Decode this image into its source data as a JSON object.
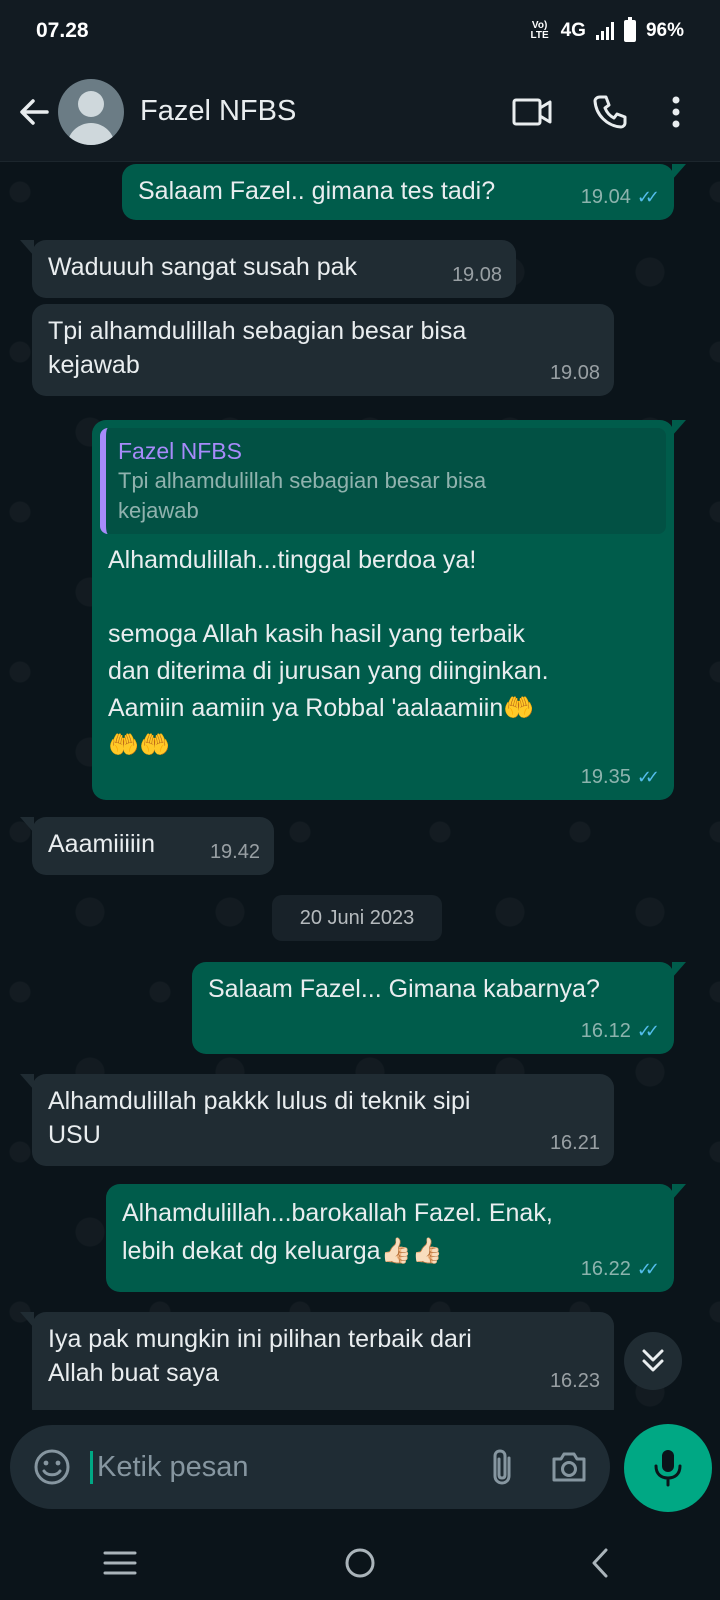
{
  "status_bar": {
    "time": "07.28",
    "volte": "Vo) LTE",
    "network": "4G",
    "battery": "96%"
  },
  "header": {
    "contact_name": "Fazel NFBS",
    "icons": [
      "back-arrow-icon",
      "video-call-icon",
      "voice-call-icon",
      "more-options-icon"
    ]
  },
  "messages": [
    {
      "dir": "out",
      "text": "Salaam Fazel.. gimana tes tadi?",
      "time": "19.04",
      "read": true
    },
    {
      "dir": "in",
      "text": "Waduuuh sangat susah pak",
      "time": "19.08"
    },
    {
      "dir": "in",
      "text": "Tpi alhamdulillah sebagian besar bisa\nkejawab",
      "time": "19.08"
    },
    {
      "dir": "out",
      "reply_to": {
        "name": "Fazel NFBS",
        "text": "Tpi alhamdulillah sebagian besar bisa\nkejawab"
      },
      "text": "Alhamdulillah...tinggal berdoa ya!\n\nsemoga Allah kasih hasil yang terbaik\ndan diterima di jurusan yang diinginkan.\nAamiin aamiin ya Robbal 'aalaamiin🤲\n🤲🤲",
      "time": "19.35",
      "read": true
    },
    {
      "dir": "in",
      "text": "Aaamiiiiin",
      "time": "19.42"
    },
    {
      "dir": "out",
      "text": "Salaam Fazel... Gimana kabarnya?",
      "time": "16.12",
      "read": true
    },
    {
      "dir": "in",
      "text": "Alhamdulillah pakkk lulus di teknik sipi\nUSU",
      "time": "16.21"
    },
    {
      "dir": "out",
      "text": "Alhamdulillah...barokallah Fazel. Enak,\nlebih dekat dg keluarga👍🏻👍🏻",
      "time": "16.22",
      "read": true
    },
    {
      "dir": "in",
      "text": "Iya pak mungkin ini pilihan terbaik dari\nAllah buat saya",
      "time": "16.23"
    }
  ],
  "date_separator": "20 Juni 2023",
  "read_ticks": "✓✓",
  "input": {
    "placeholder": "Ketik pesan",
    "value": ""
  },
  "colors": {
    "outgoing_bubble": "#005c4b",
    "incoming_bubble": "#202c33",
    "accent": "#00a884",
    "read_tick": "#53bdeb",
    "quote_name": "#a78bfa"
  }
}
